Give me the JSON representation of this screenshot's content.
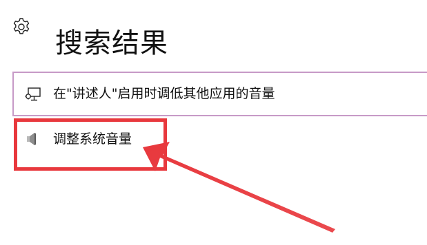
{
  "header": {
    "icon": "gear-icon",
    "title": "搜索结果"
  },
  "results": [
    {
      "icon": "monitor-settings-icon",
      "label": "在\"讲述人\"启用时调低其他应用的音量",
      "selected": true
    },
    {
      "icon": "speaker-icon",
      "label": "调整系统音量",
      "selected": false
    }
  ],
  "annotation": {
    "color": "#e8383d",
    "type": "highlight-box-with-arrow"
  }
}
